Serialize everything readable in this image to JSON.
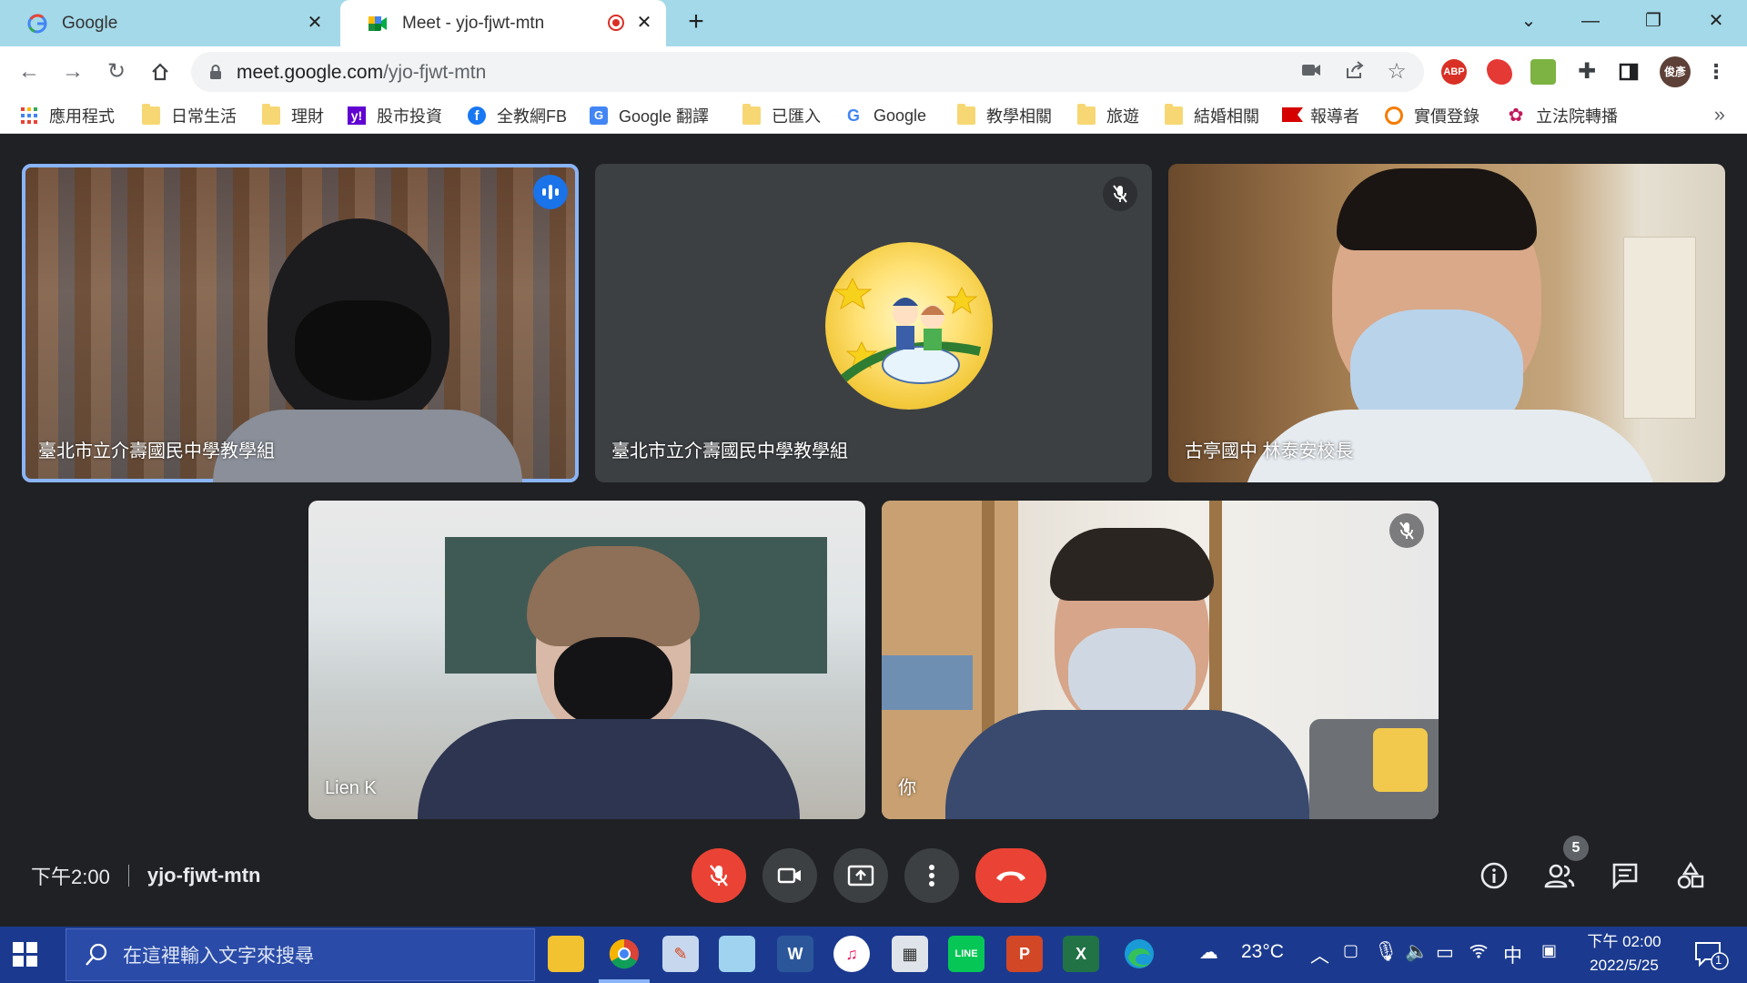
{
  "browser": {
    "tabs": [
      {
        "title": "Google",
        "active": false
      },
      {
        "title": "Meet - yjo-fjwt-mtn",
        "active": true
      }
    ],
    "url_host": "meet.google.com",
    "url_path": "/yjo-fjwt-mtn",
    "profile_initials": "俊彥",
    "extensions": [
      "ABP"
    ],
    "bookmarks": [
      {
        "label": "應用程式",
        "icon": "apps-grid-icon"
      },
      {
        "label": "日常生活",
        "icon": "folder-icon"
      },
      {
        "label": "理財",
        "icon": "folder-icon"
      },
      {
        "label": "股市投資",
        "icon": "yahoo-icon"
      },
      {
        "label": "全教網FB",
        "icon": "facebook-icon"
      },
      {
        "label": "Google 翻譯",
        "icon": "google-translate-icon"
      },
      {
        "label": "已匯入",
        "icon": "folder-icon"
      },
      {
        "label": "Google",
        "icon": "google-icon"
      },
      {
        "label": "教學相關",
        "icon": "folder-icon"
      },
      {
        "label": "旅遊",
        "icon": "folder-icon"
      },
      {
        "label": "結婚相關",
        "icon": "folder-icon"
      },
      {
        "label": "報導者",
        "icon": "flag-icon"
      },
      {
        "label": "實價登錄",
        "icon": "circle-logo-icon"
      },
      {
        "label": "立法院轉播",
        "icon": "flower-logo-icon"
      }
    ],
    "bookmarks_more": "»"
  },
  "meet": {
    "participants": [
      {
        "name": "臺北市立介壽國民中學教學組",
        "speaking": true,
        "muted": false,
        "video": true
      },
      {
        "name": "臺北市立介壽國民中學教學組",
        "speaking": false,
        "muted": true,
        "video": false
      },
      {
        "name": "古亭國中 林泰安校長",
        "speaking": false,
        "muted": false,
        "video": true
      },
      {
        "name": "Lien K",
        "speaking": false,
        "muted": false,
        "video": true
      },
      {
        "name": "你",
        "speaking": false,
        "muted": true,
        "video": true
      }
    ],
    "time": "下午2:00",
    "meeting_code": "yjo-fjwt-mtn",
    "participant_count": "5",
    "colors": {
      "end_call": "#ea4335",
      "mic_off": "#ea4335",
      "speaking_outline": "#8ab4f8",
      "stage_bg": "#202124"
    }
  },
  "taskbar": {
    "search_placeholder": "在這裡輸入文字來搜尋",
    "apps": [
      "file-explorer-icon",
      "chrome-icon",
      "paint-icon",
      "notepad-icon",
      "word-icon",
      "itunes-icon",
      "calculator-icon",
      "line-icon",
      "powerpoint-icon",
      "excel-icon",
      "edge-icon"
    ],
    "weather_temp": "23°C",
    "ime": "中",
    "clock_time": "下午 02:00",
    "clock_date": "2022/5/25",
    "notification_count": "1"
  }
}
